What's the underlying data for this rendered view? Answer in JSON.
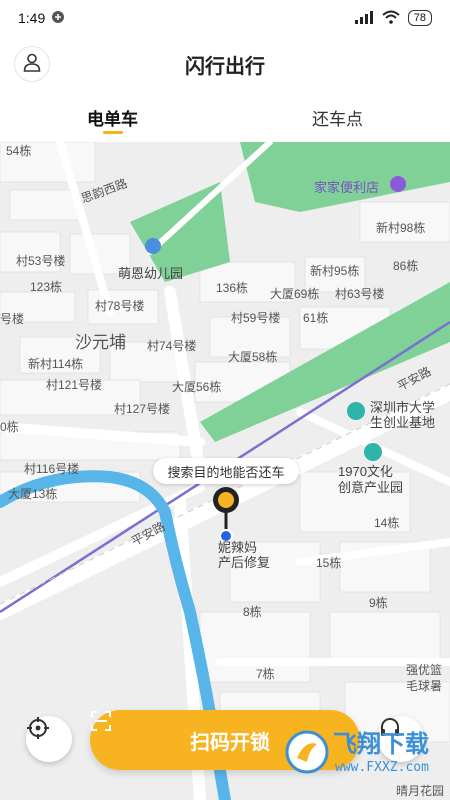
{
  "status": {
    "time": "1:49",
    "battery": "78"
  },
  "header": {
    "title": "闪行出行"
  },
  "tabs": [
    {
      "label": "电单车",
      "active": true
    },
    {
      "label": "还车点",
      "active": false
    }
  ],
  "map": {
    "labels": {
      "b54": "54栋",
      "siyun": "思韵西路",
      "lianjia": "家家便利店",
      "xincun98": "新村98栋",
      "cun53": "村53号楼",
      "mengen": "萌恩幼儿园",
      "xincun95": "新村95栋",
      "b86": "86栋",
      "b123": "123栋",
      "b136": "136栋",
      "dasha69": "大厦69栋",
      "cun63": "村63号楼",
      "cun78": "村78号楼",
      "haolou": "号楼",
      "shayuanpu": "沙元埔",
      "cun59": "村59号楼",
      "b61": "61栋",
      "cun74": "村74号楼",
      "dasha58": "大厦58栋",
      "xincun114": "新村114栋",
      "cun121": "村121号楼",
      "dasha56": "大厦56栋",
      "pinganlu1": "平安路",
      "cun127": "村127号楼",
      "shenzhen_univ": "深圳市大学\n生创业基地",
      "b0": "0栋",
      "cun116": "村116号楼",
      "park1970": "1970文化\n创意产业园",
      "dasha13": "大厦13栋",
      "b14": "14栋",
      "pinganlu2": "平安路",
      "nilama": "妮辣妈\n产后修复",
      "b15": "15栋",
      "b8": "8栋",
      "b9": "9栋",
      "b7": "7栋",
      "qiangyou": "强优篮\n毛球暑",
      "anyue": "晴月花园"
    },
    "search_tip": "搜索目的地能否还车"
  },
  "actions": {
    "scan_label": "扫码开锁"
  },
  "watermark": {
    "title": "飞翔下载",
    "url": "www.FXXZ.com"
  },
  "colors": {
    "accent": "#f7b320",
    "river": "#57b5ea",
    "park": "#7fd197",
    "road": "#ffffff",
    "rail": "#7b6fd0",
    "marker_blue": "#2266e6"
  }
}
